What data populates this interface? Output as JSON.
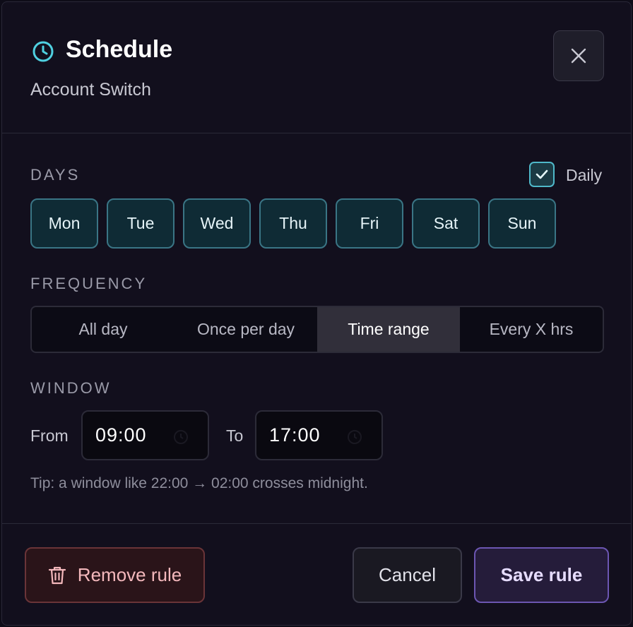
{
  "dialog": {
    "title": "Schedule",
    "subtitle": "Account Switch"
  },
  "icons": {
    "title": "clock-icon",
    "close": "close-icon",
    "daily": "check-icon",
    "time_from": "clock-icon",
    "time_to": "clock-icon",
    "remove": "trash-icon"
  },
  "days": {
    "label": "DAYS",
    "daily_label": "Daily",
    "daily_checked": true,
    "items": [
      "Mon",
      "Tue",
      "Wed",
      "Thu",
      "Fri",
      "Sat",
      "Sun"
    ]
  },
  "frequency": {
    "label": "FREQUENCY",
    "options": [
      "All day",
      "Once per day",
      "Time range",
      "Every X hrs"
    ],
    "selected": "Time range"
  },
  "window": {
    "label": "WINDOW",
    "from_label": "From",
    "from_value": "09:00",
    "to_label": "To",
    "to_value": "17:00",
    "tip": "Tip: a window like 22:00 → 02:00 crosses midnight."
  },
  "footer": {
    "remove_label": "Remove rule",
    "cancel_label": "Cancel",
    "save_label": "Save rule"
  },
  "colors": {
    "accent_teal": "#4fd0e0",
    "day_button_bg": "#0f2b35",
    "save_border": "#6c56b2",
    "remove_border": "#6a3438"
  }
}
